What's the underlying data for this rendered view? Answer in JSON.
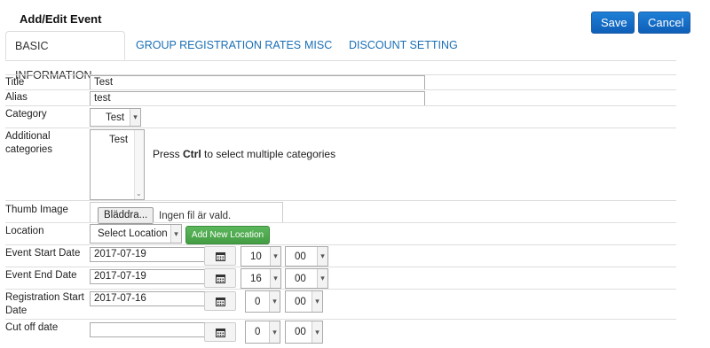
{
  "header": {
    "title": "Add/Edit Event",
    "save_label": "Save",
    "cancel_label": "Cancel"
  },
  "tabs": [
    {
      "label": "BASIC INFORMATION",
      "active": true
    },
    {
      "label": "GROUP REGISTRATION RATES"
    },
    {
      "label": "MISC"
    },
    {
      "label": "DISCOUNT SETTING"
    }
  ],
  "form": {
    "title": {
      "label": "Title",
      "value": "Test"
    },
    "alias": {
      "label": "Alias",
      "value": "test"
    },
    "category": {
      "label": "Category",
      "value": "Test"
    },
    "additional_categories": {
      "label": "Additional categories",
      "options": [
        "Test"
      ],
      "hint_prefix": "Press ",
      "hint_key": "Ctrl",
      "hint_suffix": " to select multiple categories"
    },
    "thumb_image": {
      "label": "Thumb Image",
      "button": "Bläddra...",
      "status": "Ingen fil är vald."
    },
    "location": {
      "label": "Location",
      "value": "Select Location",
      "add_button": "Add New Location"
    },
    "event_start": {
      "label": "Event Start Date",
      "date": "2017-07-19",
      "hour": "10",
      "minute": "00"
    },
    "event_end": {
      "label": "Event End Date",
      "date": "2017-07-19",
      "hour": "16",
      "minute": "00"
    },
    "registration_start": {
      "label": "Registration Start Date",
      "date": "2017-07-16",
      "hour": "0",
      "minute": "00"
    },
    "cut_off": {
      "label": "Cut off date",
      "date": "",
      "hour": "0",
      "minute": "00"
    }
  },
  "icons": {
    "calendar": "calendar-icon",
    "dropdown": "chevron-down-icon"
  },
  "colors": {
    "primary_button": "#0e5fb8",
    "success_button": "#449d44",
    "tab_link": "#1a6fb5"
  }
}
